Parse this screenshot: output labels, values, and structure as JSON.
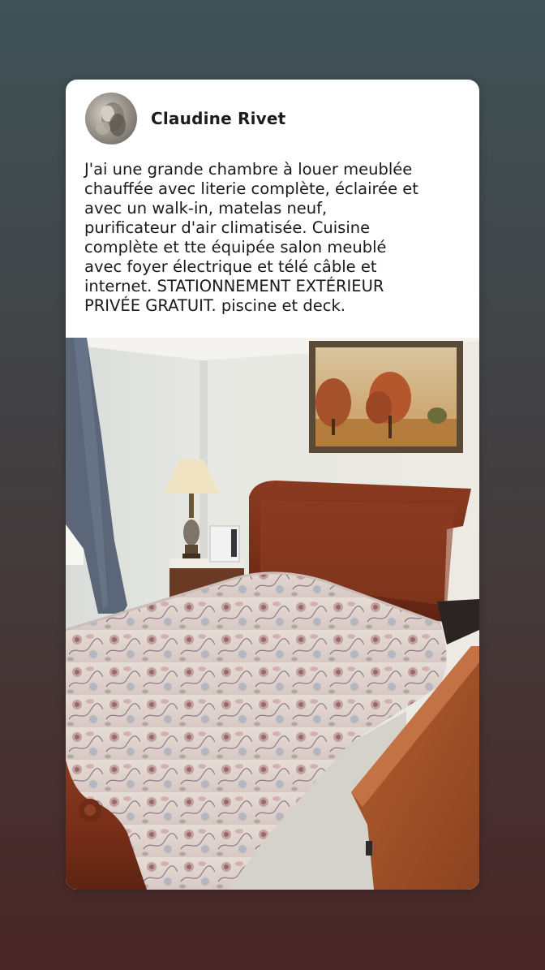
{
  "post": {
    "author": "Claudine Rivet",
    "text_lines": [
      "J'ai une grande chambre à louer meublée",
      "chauffée avec literie complète, éclairée et",
      "avec un walk-in, matelas neuf,",
      "purificateur d'air climatisée. Cuisine",
      "complète et tte équipée salon meublé",
      "avec foyer électrique et télé câble et",
      "internet. STATIONNEMENT EXTÉRIEUR",
      "PRIVÉE GRATUIT. piscine et deck."
    ]
  },
  "colors": {
    "card": "#ffffff",
    "text": "#1a1a1a",
    "background_top": "#3f5257",
    "background_bottom": "#4a2626"
  }
}
